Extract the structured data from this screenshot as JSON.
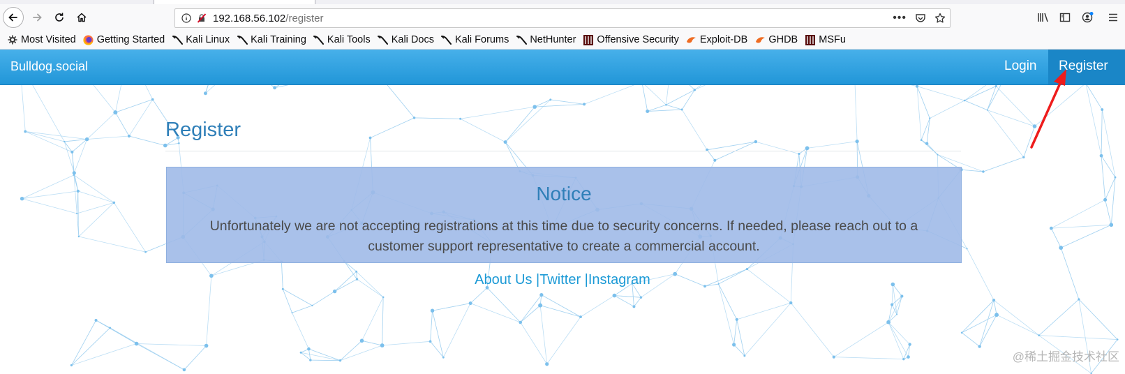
{
  "browser": {
    "url_host": "192.168.56.102",
    "url_path": "/register",
    "icons": [
      "back-arrow-icon",
      "forward-arrow-icon",
      "reload-icon",
      "home-icon",
      "info-icon",
      "insecure-lock-icon",
      "more-actions-icon",
      "pocket-icon",
      "bookmark-star-icon",
      "library-icon",
      "sidebar-icon",
      "account-icon",
      "menu-icon"
    ],
    "bookmarks": [
      {
        "label": "Most Visited",
        "icon": "gear-icon"
      },
      {
        "label": "Getting Started",
        "icon": "firefox-icon"
      },
      {
        "label": "Kali Linux",
        "icon": "kali-dragon-icon"
      },
      {
        "label": "Kali Training",
        "icon": "kali-dragon-icon"
      },
      {
        "label": "Kali Tools",
        "icon": "kali-dragon-icon"
      },
      {
        "label": "Kali Docs",
        "icon": "kali-dragon-icon"
      },
      {
        "label": "Kali Forums",
        "icon": "kali-dragon-icon"
      },
      {
        "label": "NetHunter",
        "icon": "kali-dragon-icon"
      },
      {
        "label": "Offensive Security",
        "icon": "offsec-icon"
      },
      {
        "label": "Exploit-DB",
        "icon": "exploitdb-icon"
      },
      {
        "label": "GHDB",
        "icon": "exploitdb-icon"
      },
      {
        "label": "MSFu",
        "icon": "offsec-icon"
      }
    ]
  },
  "site": {
    "brand": "Bulldog.social",
    "nav": {
      "login": "Login",
      "register": "Register"
    },
    "page_title": "Register",
    "notice": {
      "title": "Notice",
      "text": "Unfortunately we are not accepting registrations at this time due to security concerns. If needed, please reach out to a customer support representative to create a commercial account."
    },
    "footer": {
      "about": "About Us",
      "separator": "|",
      "twitter": "Twitter",
      "instagram": "Instagram"
    }
  },
  "watermark": "@稀土掘金技术社区",
  "colors": {
    "navbar": "#2a9fe0",
    "accent": "#2f7fb8",
    "notice_bg": "#a8bfe8",
    "link": "#1c9ad6",
    "annotation_arrow": "#ee1c1c"
  }
}
